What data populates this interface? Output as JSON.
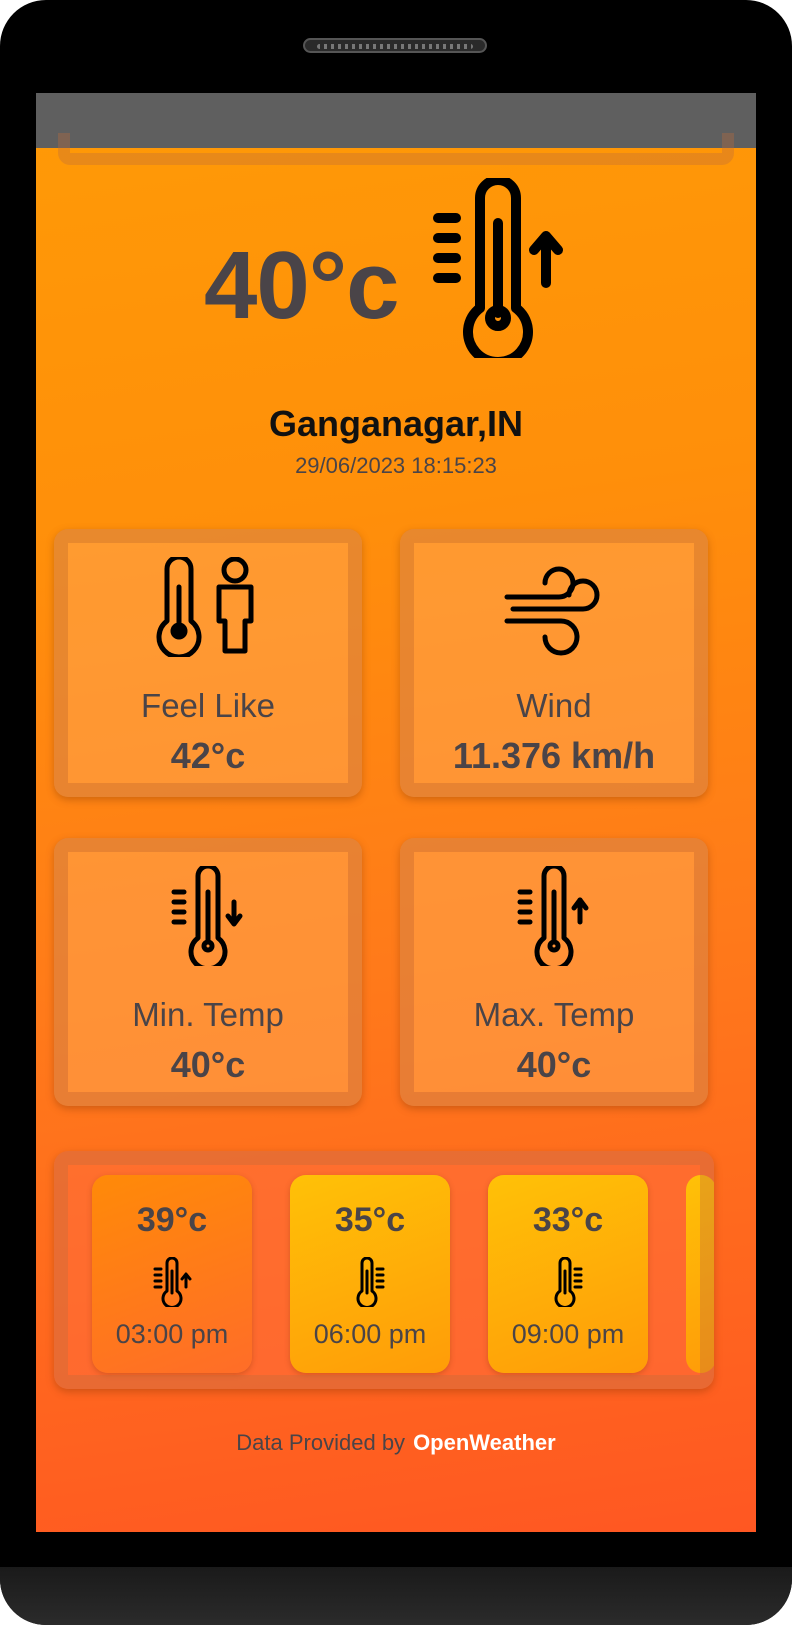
{
  "hero": {
    "temperature": "40°c",
    "icon": "thermometer-rising-icon"
  },
  "location": {
    "city": "Ganganagar,IN",
    "datetime": "29/06/2023 18:15:23"
  },
  "tiles": [
    {
      "label": "Feel Like",
      "value": "42°c",
      "icon": "thermometer-person-icon"
    },
    {
      "label": "Wind",
      "value": "11.376 km/h",
      "icon": "wind-icon"
    },
    {
      "label": "Min. Temp",
      "value": "40°c",
      "icon": "thermometer-down-icon"
    },
    {
      "label": "Max. Temp",
      "value": "40°c",
      "icon": "thermometer-up-icon"
    }
  ],
  "forecast": [
    {
      "temp": "39°c",
      "time": "03:00 pm",
      "icon": "thermometer-up-icon",
      "active": true
    },
    {
      "temp": "35°c",
      "time": "06:00 pm",
      "icon": "thermometer-icon",
      "active": false
    },
    {
      "temp": "33°c",
      "time": "09:00 pm",
      "icon": "thermometer-icon",
      "active": false
    }
  ],
  "footer": {
    "text": "Data Provided by",
    "brand": "OpenWeather"
  },
  "colors": {
    "gradient_top": "#ff9a06",
    "gradient_bottom": "#ff5722",
    "text_dark": "#4a4448",
    "card_yellow": "#ffc107"
  }
}
